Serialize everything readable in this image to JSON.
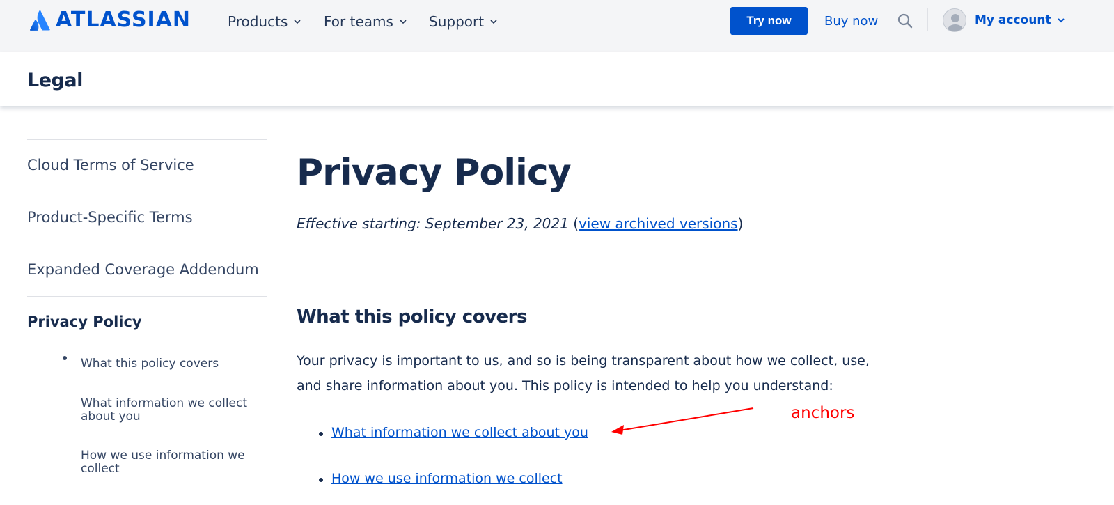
{
  "nav": {
    "logo_text": "ATLASSIAN",
    "items": [
      {
        "label": "Products"
      },
      {
        "label": "For teams"
      },
      {
        "label": "Support"
      }
    ],
    "try_now": "Try now",
    "buy_now": "Buy now",
    "account": "My account",
    "accent": "#0052cc",
    "background": "#f4f5f7"
  },
  "subheader": {
    "title": "Legal"
  },
  "sidebar": {
    "items": [
      {
        "label": "Cloud Terms of Service"
      },
      {
        "label": "Product-Specific Terms"
      },
      {
        "label": "Expanded Coverage Addendum"
      },
      {
        "label": "Privacy Policy"
      }
    ],
    "subitems": [
      {
        "label": "What this policy covers"
      },
      {
        "label": "What information we collect about you"
      },
      {
        "label": "How we use information we collect"
      }
    ]
  },
  "main": {
    "title": "Privacy Policy",
    "effective_label": "Effective starting: September 23, 2021",
    "archived_link": "view archived versions",
    "section_title": "What this policy covers",
    "paragraph": "Your privacy is important to us, and so is being transparent about how we collect, use, and share information about you. This policy is intended to help you understand:",
    "anchors": [
      {
        "label": "What information we collect about you"
      },
      {
        "label": "How we use information we collect "
      }
    ]
  },
  "annotation": {
    "text": "anchors",
    "color": "#ff0000"
  },
  "icons": {
    "search": "search-icon",
    "avatar": "user-icon",
    "chevron": "chevron-down-icon",
    "logo": "atlassian-logo-icon"
  }
}
